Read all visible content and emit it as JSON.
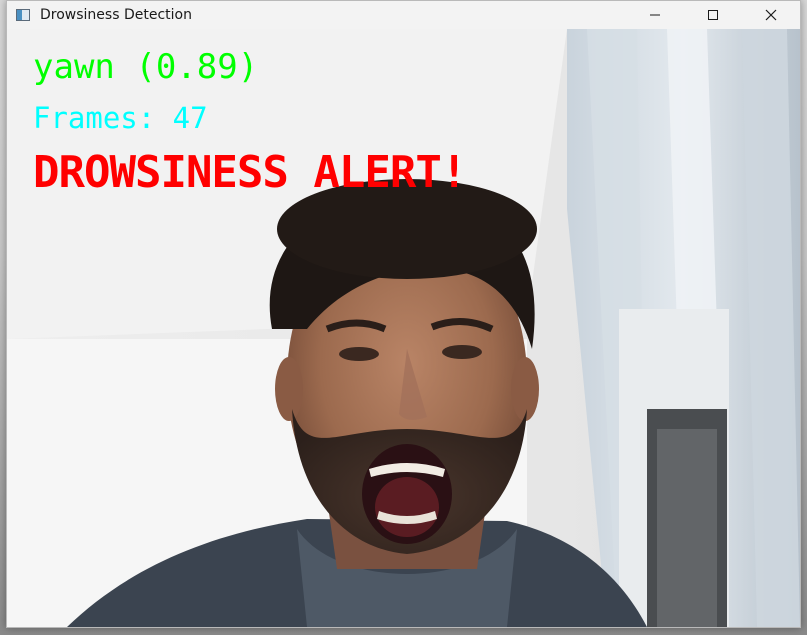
{
  "window": {
    "title": "Drowsiness Detection"
  },
  "controls": {
    "minimize_icon": "minimize-icon",
    "maximize_icon": "maximize-icon",
    "close_icon": "close-icon"
  },
  "overlay": {
    "prediction": "yawn (0.89)",
    "frames": "Frames: 47",
    "alert": "DROWSINESS ALERT!"
  },
  "colors": {
    "prediction": "#00ff00",
    "frames": "#00ffff",
    "alert": "#ff0000",
    "titlebar": "#f3f3f3"
  }
}
